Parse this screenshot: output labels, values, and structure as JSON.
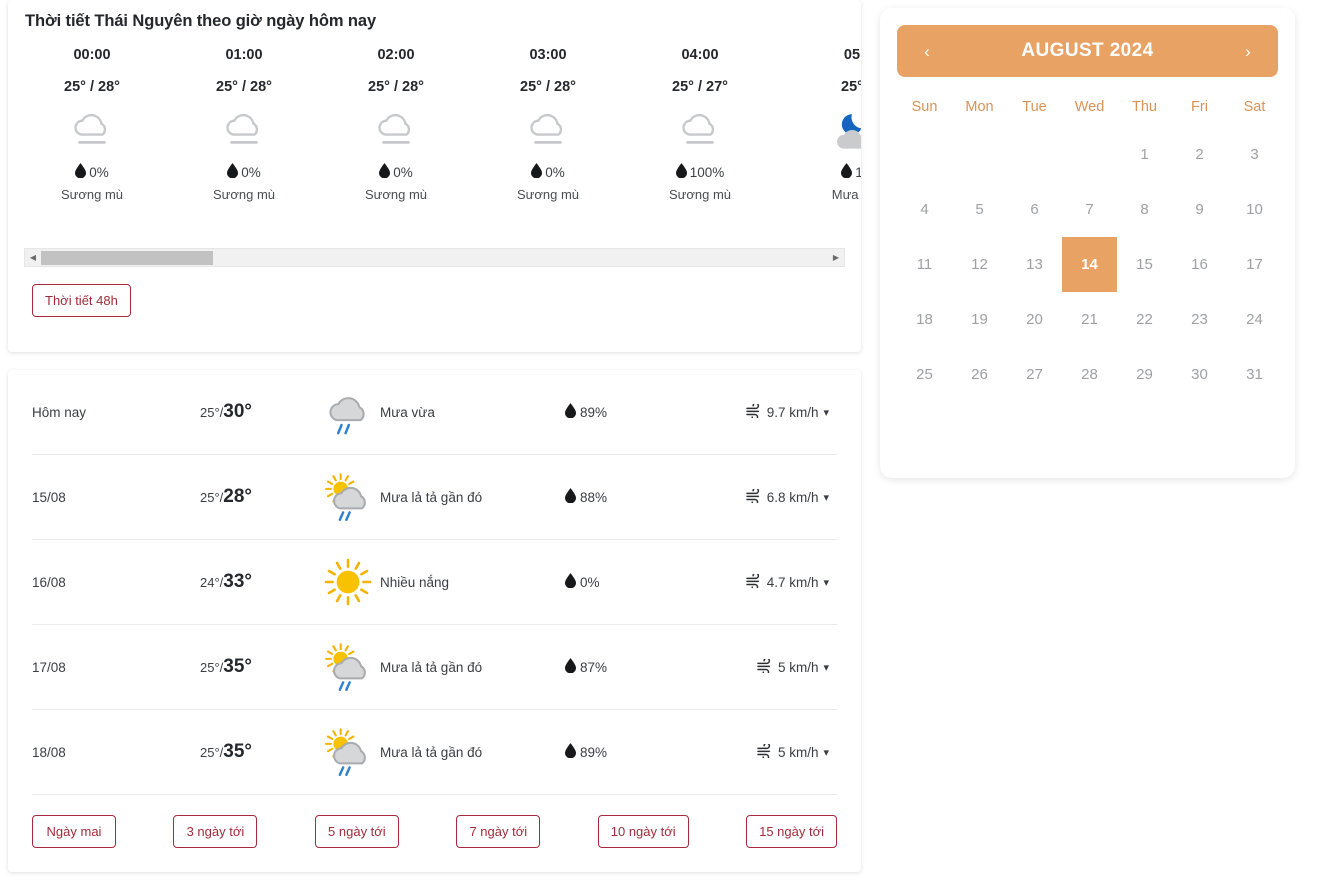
{
  "hourly": {
    "title": "Thời tiết Thái Nguyên theo giờ ngày hôm nay",
    "button_48h": "Thời tiết 48h",
    "columns": [
      {
        "time": "00:00",
        "temp": "25° / 28°",
        "icon": "fog-cloud-icon",
        "pop": "0%",
        "desc": "Sương mù"
      },
      {
        "time": "01:00",
        "temp": "25° / 28°",
        "icon": "fog-cloud-icon",
        "pop": "0%",
        "desc": "Sương mù"
      },
      {
        "time": "02:00",
        "temp": "25° / 28°",
        "icon": "fog-cloud-icon",
        "pop": "0%",
        "desc": "Sương mù"
      },
      {
        "time": "03:00",
        "temp": "25° / 28°",
        "icon": "fog-cloud-icon",
        "pop": "0%",
        "desc": "Sương mù"
      },
      {
        "time": "04:00",
        "temp": "25° / 27°",
        "icon": "fog-cloud-icon",
        "pop": "100%",
        "desc": "Sương mù"
      },
      {
        "time": "05",
        "temp": "25°",
        "icon": "moon-cloud-icon",
        "pop": "1",
        "desc": "Mưa lả"
      }
    ]
  },
  "daily": {
    "rows": [
      {
        "date": "Hôm nay",
        "tmin": "25°/",
        "tmax": "30°",
        "icon": "rain-cloud-icon",
        "condition": "Mưa vừa",
        "humidity": "89%",
        "wind": "9.7 km/h"
      },
      {
        "date": "15/08",
        "tmin": "25°/",
        "tmax": "28°",
        "icon": "sun-cloud-rain-icon",
        "condition": "Mưa lả tả gần đó",
        "humidity": "88%",
        "wind": "6.8 km/h"
      },
      {
        "date": "16/08",
        "tmin": "24°/",
        "tmax": "33°",
        "icon": "sun-icon",
        "condition": "Nhiều nắng",
        "humidity": "0%",
        "wind": "4.7 km/h"
      },
      {
        "date": "17/08",
        "tmin": "25°/",
        "tmax": "35°",
        "icon": "sun-cloud-rain-icon",
        "condition": "Mưa lả tả gần đó",
        "humidity": "87%",
        "wind": "5 km/h"
      },
      {
        "date": "18/08",
        "tmin": "25°/",
        "tmax": "35°",
        "icon": "sun-cloud-rain-icon",
        "condition": "Mưa lả tả gần đó",
        "humidity": "89%",
        "wind": "5 km/h"
      }
    ],
    "range_buttons": [
      "Ngày mai",
      "3 ngày tới",
      "5 ngày tới",
      "7 ngày tới",
      "10 ngày tới",
      "15 ngày tới"
    ]
  },
  "calendar": {
    "title": "AUGUST 2024",
    "prev_icon": "chevron-left-icon",
    "next_icon": "chevron-right-icon",
    "weekdays": [
      "Sun",
      "Mon",
      "Tue",
      "Wed",
      "Thu",
      "Fri",
      "Sat"
    ],
    "lead_blanks": 4,
    "days": [
      1,
      2,
      3,
      4,
      5,
      6,
      7,
      8,
      9,
      10,
      11,
      12,
      13,
      14,
      15,
      16,
      17,
      18,
      19,
      20,
      21,
      22,
      23,
      24,
      25,
      26,
      27,
      28,
      29,
      30,
      31
    ],
    "selected_day": 14,
    "accent_color": "#e8a264",
    "weekday_color": "#d99355"
  },
  "theme": {
    "outline_button_color": "#a02c3a",
    "rain_streak_color": "#2d7fd0",
    "sun_color": "#f8c200",
    "cloud_gray": "#c6c8ca"
  }
}
